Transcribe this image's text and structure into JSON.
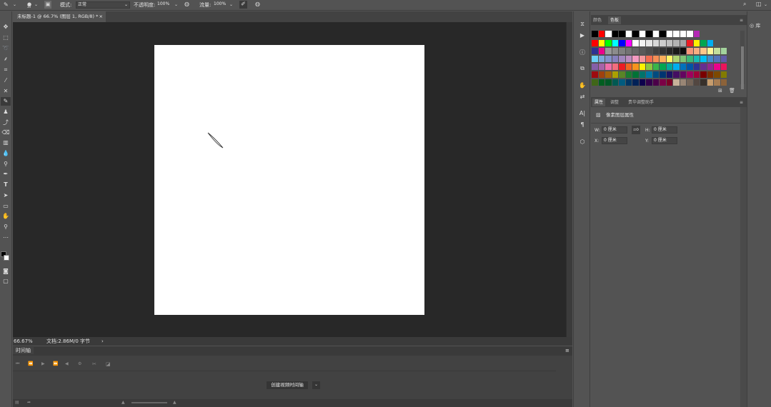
{
  "options_bar": {
    "brush_size": "33",
    "mode_label": "模式:",
    "mode_value": "正常",
    "opacity_label": "不透明度:",
    "opacity_value": "100%",
    "flow_label": "流量:",
    "flow_value": "100%"
  },
  "document_tab": {
    "title": "未标题-1 @ 66.7% (图层 1, RGB/8) *",
    "close": "×"
  },
  "status_bar": {
    "zoom": "66.67%",
    "doc_info": "文档:2.86M/0 字节",
    "arrow": "›"
  },
  "timeline": {
    "title": "时间轴",
    "create_button": "创建视频时间轴"
  },
  "swatch_panel": {
    "tab_color": "颜色",
    "tab_swatches": "色板"
  },
  "properties_panel": {
    "tab_properties": "属性",
    "tab_adjustments": "调整",
    "tab_extra": "贵华调整助手",
    "section_title": "像素图层属性",
    "w_label": "W:",
    "w_value": "0 厘米",
    "h_label": "H:",
    "h_value": "0 厘米",
    "x_label": "X:",
    "x_value": "0 厘米",
    "y_label": "Y:",
    "y_value": "0 厘米",
    "link_icon_text": "ගo"
  },
  "library": {
    "label": "库"
  },
  "swatch_colors": [
    [
      "#000000",
      "#ff0000",
      "#ffffff",
      "#000000",
      "#000000",
      "#ffffff",
      "#000000",
      "#ffffff",
      "#000000",
      "#ffffff",
      "#000000",
      "#ffffff",
      "#ffffff",
      "#ffffff",
      "#ffffff",
      "#b428b4"
    ],
    [
      "#ff0000",
      "#ffff00",
      "#00ff00",
      "#00ffff",
      "#0000ff",
      "#ff00ff",
      "#ffffff",
      "#f2f2f2",
      "#e6e6e6",
      "#d9d9d9",
      "#cccccc",
      "#bfbfbf",
      "#b3b3b3",
      "#a6a6a6",
      "#ee1d24",
      "#fff200",
      "#00a650",
      "#00aeef"
    ],
    [
      "#2e3192",
      "#ec008c",
      "#999999",
      "#8c8c8c",
      "#808080",
      "#737373",
      "#666666",
      "#595959",
      "#4d4d4d",
      "#404040",
      "#333333",
      "#262626",
      "#1a1a1a",
      "#0d0d0d",
      "#f7977a",
      "#f9ad81",
      "#fdc68a",
      "#fff79a",
      "#c4df9b",
      "#a3d39c"
    ],
    [
      "#6dcff6",
      "#7da7d8",
      "#8393ca",
      "#8781bd",
      "#a186be",
      "#bd8cbf",
      "#f49ac1",
      "#f5989d",
      "#f26c4f",
      "#f68e55",
      "#fbaf5c",
      "#fff467",
      "#acd372",
      "#7cc576",
      "#3bb878",
      "#1abbb4",
      "#00bff3",
      "#438ccb",
      "#5574b9",
      "#605ca8"
    ],
    [
      "#855fa8",
      "#a763a8",
      "#f06ea9",
      "#f26d7d",
      "#ed1c24",
      "#f26522",
      "#f7941d",
      "#fff200",
      "#8dc63f",
      "#39b54a",
      "#00a651",
      "#00a99d",
      "#00aeef",
      "#0072bc",
      "#0054a6",
      "#2e3192",
      "#662d91",
      "#92278f",
      "#ec008c",
      "#ed145b"
    ],
    [
      "#9e0b0f",
      "#a0410d",
      "#a3620a",
      "#aba000",
      "#598527",
      "#1a7b30",
      "#007236",
      "#00746b",
      "#0076a3",
      "#004b80",
      "#003471",
      "#1b1464",
      "#440e62",
      "#630460",
      "#9e005d",
      "#9e0039",
      "#790000",
      "#7b2e00",
      "#7d4900",
      "#827b00"
    ],
    [
      "#406618",
      "#005e20",
      "#005826",
      "#005952",
      "#005b7f",
      "#003663",
      "#002157",
      "#0d004c",
      "#32004b",
      "#4b0049",
      "#7b0046",
      "#7a0026",
      "#c7b299",
      "#998675",
      "#736357",
      "#534741",
      "#37302a",
      "#c69c6d",
      "#a67c52",
      "#8c6239"
    ]
  ]
}
